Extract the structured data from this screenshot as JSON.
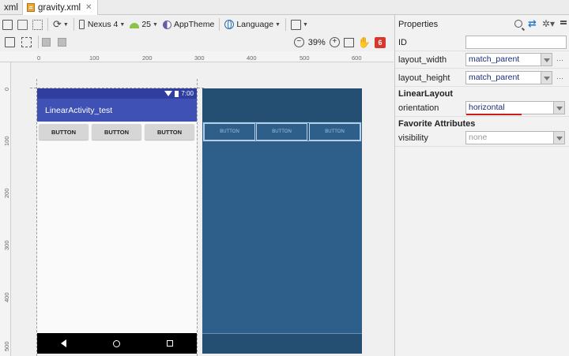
{
  "tabs": [
    {
      "label": "xml",
      "active": false
    },
    {
      "label": "gravity.xml",
      "active": true
    }
  ],
  "toolbar": {
    "device": "Nexus 4",
    "api_level": "25",
    "theme": "AppTheme",
    "language": "Language"
  },
  "zoom": {
    "level": "39%",
    "minus": "−",
    "plus": "+",
    "error_count": "6"
  },
  "ruler": {
    "top": [
      "0",
      "100",
      "200",
      "300",
      "400",
      "500",
      "600"
    ],
    "left": [
      "0",
      "100",
      "200",
      "300",
      "400",
      "500"
    ]
  },
  "preview": {
    "status_time": "7:00",
    "app_title": "LinearActivity_test",
    "buttons": [
      "BUTTON",
      "BUTTON",
      "BUTTON"
    ]
  },
  "blueprint": {
    "buttons": [
      "BUTTON",
      "BUTTON",
      "BUTTON"
    ]
  },
  "properties": {
    "title": "Properties",
    "id_label": "ID",
    "id_value": "",
    "layout_width_label": "layout_width",
    "layout_width_value": "match_parent",
    "layout_height_label": "layout_height",
    "layout_height_value": "match_parent",
    "section_linear": "LinearLayout",
    "orientation_label": "orientation",
    "orientation_value": "horizontal",
    "section_favorite": "Favorite Attributes",
    "visibility_label": "visibility",
    "visibility_value": "none",
    "more": "···"
  },
  "colors": {
    "app_bar": "#3f51b5",
    "status_bar": "#303f9f",
    "blueprint": "#2e5f8a",
    "error": "#d9362e"
  }
}
